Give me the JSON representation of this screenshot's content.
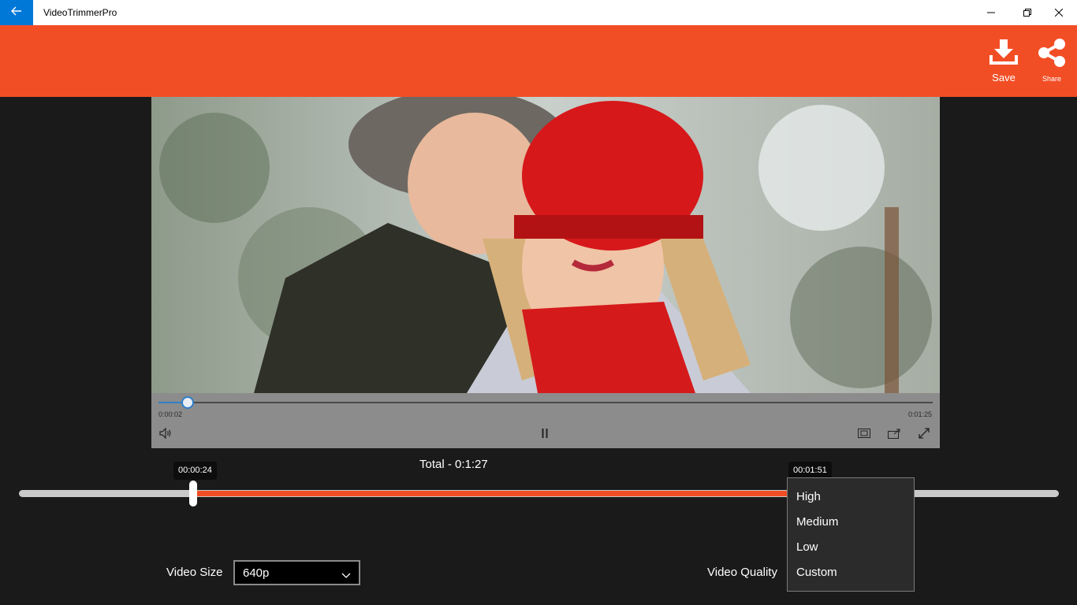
{
  "window": {
    "title": "VideoTrimmerPro"
  },
  "header": {
    "save_label": "Save",
    "share_label": "Share",
    "accent_color": "#f24e26"
  },
  "player": {
    "current_time": "0:00:02",
    "total_time": "0:01:25",
    "progress": 0.038,
    "icons": [
      "volume-icon",
      "pause-icon",
      "aspect-ratio-icon",
      "cast-icon",
      "fullscreen-icon"
    ]
  },
  "trim": {
    "total_label": "Total - 0:1:27",
    "start_time": "00:00:24",
    "end_time": "00:01:51",
    "start_fraction": 0.168,
    "end_fraction": 0.745,
    "range_color": "#f24e26"
  },
  "settings": {
    "video_size_label": "Video Size",
    "video_size_value": "640p",
    "video_quality_label": "Video Quality",
    "quality_options": [
      "High",
      "Medium",
      "Low",
      "Custom"
    ]
  }
}
